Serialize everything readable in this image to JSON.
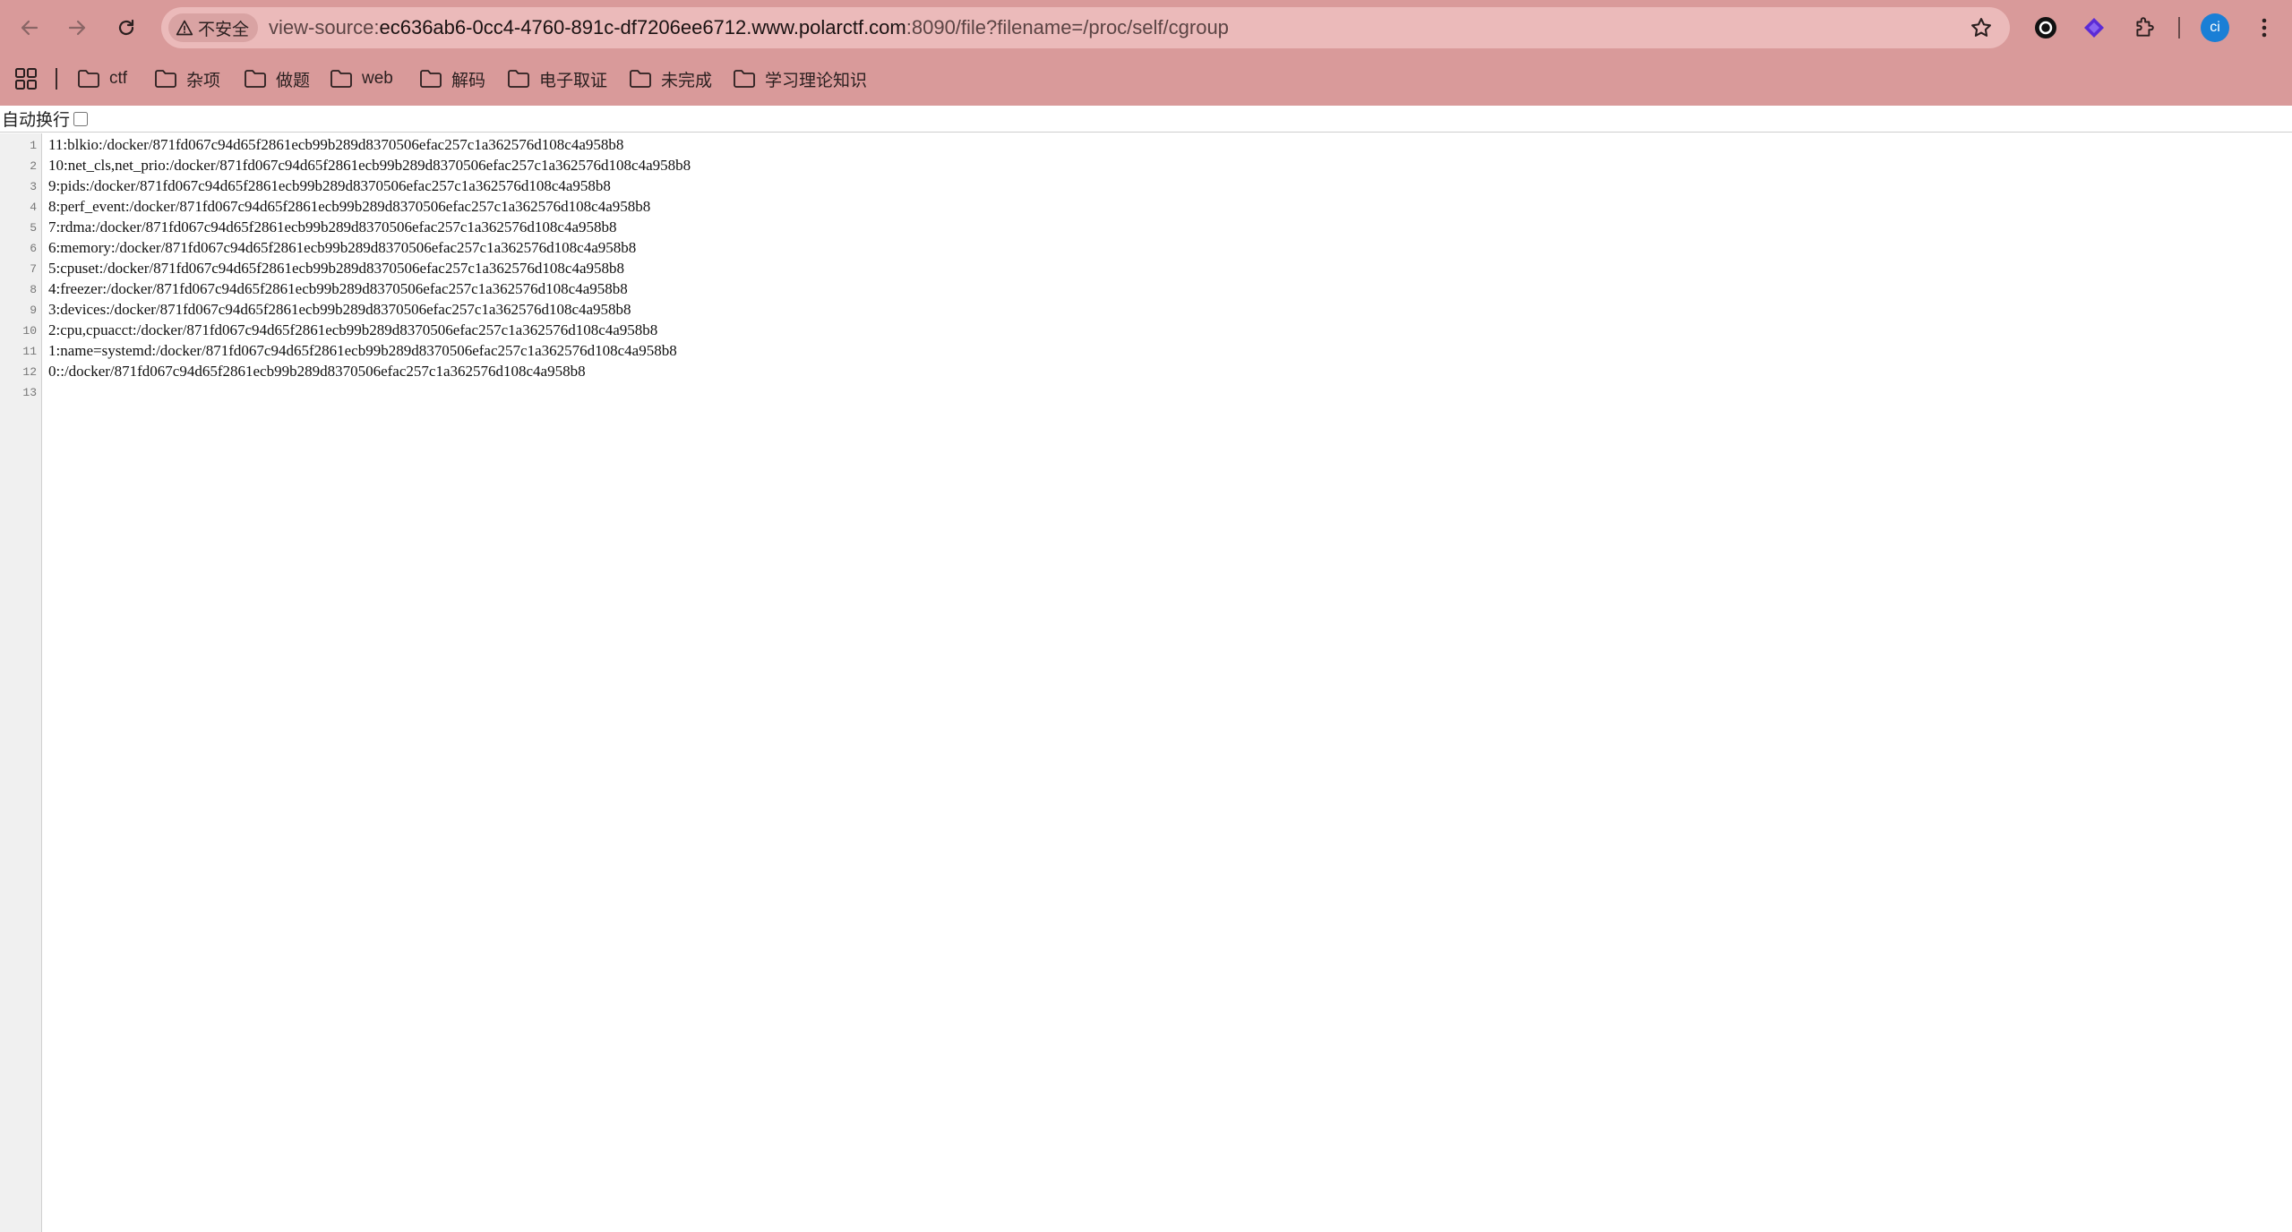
{
  "browser": {
    "security_label": "不安全",
    "url_scheme": "view-source:",
    "url_host": "ec636ab6-0cc4-4760-891c-df7206ee6712.www.polarctf.com",
    "url_rest": ":8090/file?filename=/proc/self/cgroup",
    "avatar_initials": "ci",
    "icons": {
      "back": "arrow-left-icon",
      "forward": "arrow-right-icon",
      "reload": "reload-icon",
      "security": "warning-triangle-icon",
      "bookmark": "star-outline-icon",
      "extension_1": "circle-record-icon",
      "extension_2": "purple-diamond-icon",
      "extensions": "puzzle-icon",
      "menu": "kebab-menu-icon"
    },
    "accent_color": "#d99a9a"
  },
  "bookmarks": [
    {
      "label": "ctf"
    },
    {
      "label": "杂项"
    },
    {
      "label": "做题"
    },
    {
      "label": "web"
    },
    {
      "label": "解码"
    },
    {
      "label": "电子取证"
    },
    {
      "label": "未完成"
    },
    {
      "label": "学习理论知识"
    }
  ],
  "viewer": {
    "wrap_label": "自动换行",
    "wrap_checked": false,
    "lines": [
      {
        "no": "1",
        "text": "11:blkio:/docker/871fd067c94d65f2861ecb99b289d8370506efac257c1a362576d108c4a958b8"
      },
      {
        "no": "2",
        "text": "10:net_cls,net_prio:/docker/871fd067c94d65f2861ecb99b289d8370506efac257c1a362576d108c4a958b8"
      },
      {
        "no": "3",
        "text": "9:pids:/docker/871fd067c94d65f2861ecb99b289d8370506efac257c1a362576d108c4a958b8"
      },
      {
        "no": "4",
        "text": "8:perf_event:/docker/871fd067c94d65f2861ecb99b289d8370506efac257c1a362576d108c4a958b8"
      },
      {
        "no": "5",
        "text": "7:rdma:/docker/871fd067c94d65f2861ecb99b289d8370506efac257c1a362576d108c4a958b8"
      },
      {
        "no": "6",
        "text": "6:memory:/docker/871fd067c94d65f2861ecb99b289d8370506efac257c1a362576d108c4a958b8"
      },
      {
        "no": "7",
        "text": "5:cpuset:/docker/871fd067c94d65f2861ecb99b289d8370506efac257c1a362576d108c4a958b8"
      },
      {
        "no": "8",
        "text": "4:freezer:/docker/871fd067c94d65f2861ecb99b289d8370506efac257c1a362576d108c4a958b8"
      },
      {
        "no": "9",
        "text": "3:devices:/docker/871fd067c94d65f2861ecb99b289d8370506efac257c1a362576d108c4a958b8"
      },
      {
        "no": "10",
        "text": "2:cpu,cpuacct:/docker/871fd067c94d65f2861ecb99b289d8370506efac257c1a362576d108c4a958b8"
      },
      {
        "no": "11",
        "text": "1:name=systemd:/docker/871fd067c94d65f2861ecb99b289d8370506efac257c1a362576d108c4a958b8"
      },
      {
        "no": "12",
        "text": "0::/docker/871fd067c94d65f2861ecb99b289d8370506efac257c1a362576d108c4a958b8"
      },
      {
        "no": "13",
        "text": ""
      }
    ]
  }
}
